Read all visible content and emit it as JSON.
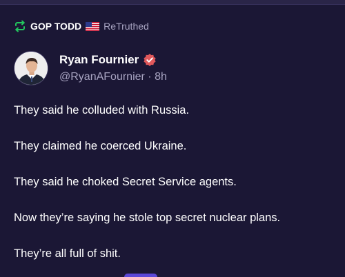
{
  "retruth": {
    "user": "GOP TODD",
    "label": "ReTruthed",
    "icon": "retruth-arrows-icon",
    "flag": "us-flag-icon",
    "accent_color": "#22c55e"
  },
  "author": {
    "name": "Ryan Fournier",
    "handle": "@RyanAFournier",
    "separator": "·",
    "time": "8h",
    "verified_icon": "verified-badge-icon",
    "verified_color": "#e0585b"
  },
  "post": {
    "lines": [
      "They said he colluded with Russia.",
      "They claimed he coerced Ukraine.",
      "They said he choked Secret Service agents.",
      "Now they’re saying he stole top secret nuclear plans.",
      "They’re all full of shit."
    ]
  },
  "colors": {
    "background": "#1b1735",
    "muted_text": "#a9a5c2",
    "text": "#ffffff"
  }
}
